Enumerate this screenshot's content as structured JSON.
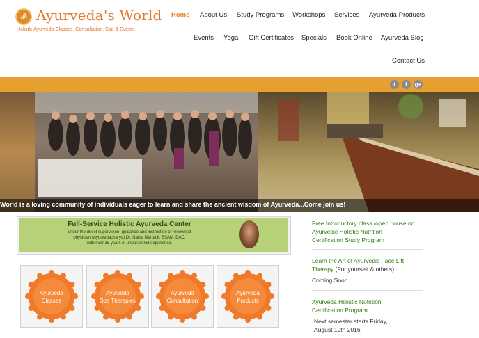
{
  "header": {
    "logo_title": "Ayurveda's World",
    "logo_subtitle": "Holistic Ayurveda Classes, Consultation, Spa & Events",
    "logo_icon": "om-icon"
  },
  "nav": {
    "items": [
      {
        "label": "Home",
        "active": true
      },
      {
        "label": "About Us"
      },
      {
        "label": "Study Programs"
      },
      {
        "label": "Workshops"
      },
      {
        "label": "Services"
      },
      {
        "label": "Ayurveda Products"
      },
      {
        "label": "Events"
      },
      {
        "label": "Yoga"
      },
      {
        "label": "Gift Certificates"
      },
      {
        "label": "Specials"
      },
      {
        "label": "Book Online"
      },
      {
        "label": "Ayurveda Blog"
      },
      {
        "label": "Contact Us"
      }
    ]
  },
  "social": {
    "twitter": "t",
    "facebook": "f",
    "google": "g+"
  },
  "banner": {
    "caption": "World is a loving community of individuals eager to learn and share the ancient wisdom of Ayurveda...Come join us!"
  },
  "promo": {
    "title": "Full-Service Holistic Ayurveda Center",
    "line1": "under the direct supervision, guidance and instruction of renowned",
    "line2": "physician (Ayurvedacharya) Dr. Naina Marballi, BSAM, DAC,",
    "line3": "with over 35 years of unparalleled experience."
  },
  "tiles": [
    {
      "line1": "Ayurveda",
      "line2": "Classes"
    },
    {
      "line1": "Ayurveda",
      "line2": "Spa Therapies"
    },
    {
      "line1": "Ayurveda",
      "line2": "Consultation"
    },
    {
      "line1": "Ayurveda",
      "line2": "Products"
    }
  ],
  "sidebar": {
    "news1": {
      "line1": "Free Introductory class /open house on",
      "line2": "Ayurvedic Holistic Nutrition",
      "line3": "Certification Study Program"
    },
    "news2": {
      "line1": "Learn the Art of Ayurvedic Face Lift",
      "line2": "Therapy",
      "line2_extra": " (For yourself & others)",
      "status": "Coming Soon"
    },
    "news3": {
      "line1": "Ayurveda Holistic Nutrition",
      "line2": "Certification Program",
      "line3": "Next semester starts Friday,",
      "line4": "August 19th 2016"
    }
  },
  "colors": {
    "accent": "#e08a2a",
    "band": "#e6a030",
    "promo_green": "#b7d179",
    "link_green": "#2e7d0f",
    "badge_orange": "#ee7a2a"
  }
}
